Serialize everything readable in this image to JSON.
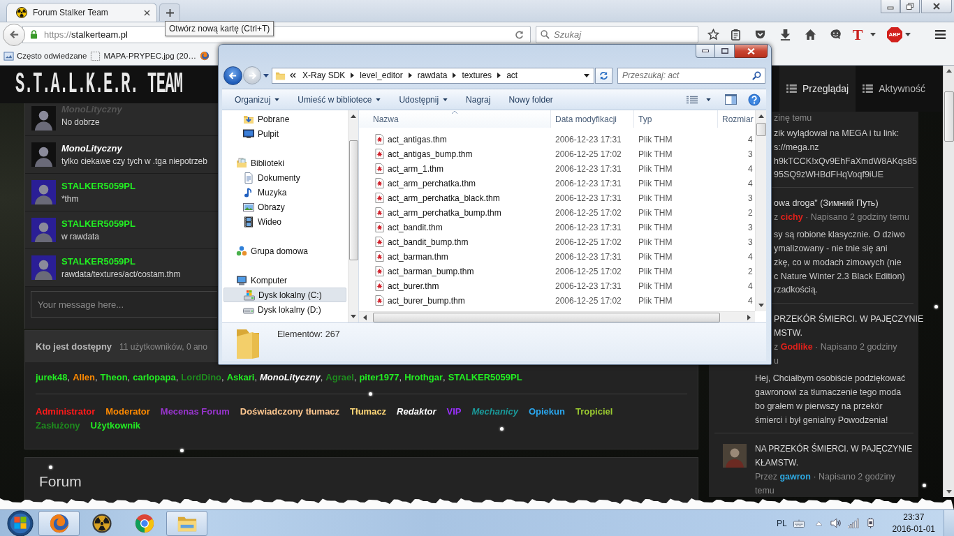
{
  "browser": {
    "tabs": [
      {
        "title": "Forum Stalker Team",
        "selected": true
      }
    ],
    "tooltip": "Otwórz nową kartę (Ctrl+T)",
    "url": {
      "scheme": "https://",
      "host": "stalkerteam.pl"
    },
    "search": {
      "placeholder": "Szukaj"
    },
    "extension_label": "T",
    "adblock_label": "ABP",
    "bookmarks": [
      {
        "label": "Często odwiedzane"
      },
      {
        "label": "MAPA-PRYPEC.jpg (20…"
      }
    ]
  },
  "page": {
    "logo": "S.T.A.L.K.E.R. TEAM",
    "nav": [
      {
        "label": "Przeglądaj",
        "selected": true
      },
      {
        "label": "Aktywność",
        "selected": false
      }
    ],
    "chat": {
      "messages": [
        {
          "author": "MonoLityczny",
          "color": "#555555",
          "italic": true,
          "avatar": {
            "color": "#101010"
          },
          "text": "No dobrze"
        },
        {
          "author": "MonoLityczny",
          "color": "#ffffff",
          "italic": true,
          "avatar": {
            "color": "#101010"
          },
          "text": "tylko ciekawe czy tych w .tga niepotrzeb"
        },
        {
          "author": "STALKER5059PL",
          "color": "#22ee22",
          "italic": false,
          "avatar": {
            "color": "#2a1e96"
          },
          "text": "*thm"
        },
        {
          "author": "STALKER5059PL",
          "color": "#22ee22",
          "italic": false,
          "avatar": {
            "color": "#2a1e96"
          },
          "text": "w rawdata"
        },
        {
          "author": "STALKER5059PL",
          "color": "#22ee22",
          "italic": false,
          "avatar": {
            "color": "#2a1e96"
          },
          "text": "rawdata/textures/act/costam.thm"
        }
      ],
      "input": {
        "placeholder": "Your message here..."
      }
    },
    "online": {
      "title": "Kto jest dostępny",
      "summary": "11 użytkowników, 0 ano",
      "users": [
        {
          "name": "jurek48",
          "color": "#22ee22",
          "italic": false,
          "separator": ","
        },
        {
          "name": "Allen",
          "color": "#ff8a00",
          "italic": false,
          "separator": ","
        },
        {
          "name": "Theon",
          "color": "#22ee22",
          "italic": false,
          "separator": ","
        },
        {
          "name": "carlopapa",
          "color": "#22ee22",
          "italic": false,
          "separator": ","
        },
        {
          "name": "LordDino",
          "color": "#1e8b1e",
          "italic": false,
          "separator": ","
        },
        {
          "name": "Askari",
          "color": "#22ee22",
          "italic": false,
          "separator": ","
        },
        {
          "name": "MonoLityczny",
          "color": "#ffffff",
          "italic": true,
          "separator": ","
        },
        {
          "name": "Agrael",
          "color": "#1e8b1e",
          "italic": false,
          "separator": ","
        },
        {
          "name": "piter1977",
          "color": "#22ee22",
          "italic": false,
          "separator": ","
        },
        {
          "name": "Hrothgar",
          "color": "#22ee22",
          "italic": false,
          "separator": ","
        },
        {
          "name": "STALKER5059PL",
          "color": "#22ee22",
          "italic": false
        }
      ],
      "roles": [
        {
          "label": "Administrator",
          "color": "#ff1a1a",
          "italic": false
        },
        {
          "label": "Moderator",
          "color": "#ff8a00",
          "italic": false
        },
        {
          "label": "Mecenas Forum",
          "color": "#9a35d0",
          "italic": false
        },
        {
          "label": "Doświadczony tłumacz",
          "color": "#ffc890",
          "italic": false
        },
        {
          "label": "Tłumacz",
          "color": "#ffd878",
          "italic": false
        },
        {
          "label": "Redaktor",
          "color": "#ffffff",
          "italic": true
        },
        {
          "label": "VIP",
          "color": "#9b30ff",
          "italic": false
        },
        {
          "label": "Mechanicy",
          "color": "#1a9a9a",
          "italic": true
        },
        {
          "label": "Opiekun",
          "color": "#2aa8f0",
          "italic": false
        },
        {
          "label": "Tropiciel",
          "color": "#9ccc30",
          "italic": false
        },
        {
          "label": "Zasłużony",
          "color": "#1e8b1e",
          "italic": false
        },
        {
          "label": "Użytkownik",
          "color": "#22ee22",
          "italic": false
        }
      ]
    },
    "forum": {
      "title": "Forum"
    },
    "activity": {
      "posts": [
        {
          "kind": "covered",
          "meta": {
            "date": "zinę temu"
          },
          "body_lines": [
            "zik wylądował na MEGA i tu link:",
            "s://mega.nz",
            "h9kTCCK!xQv9EhFaXmdW8AKqs85",
            "95SQ9zWHBdFHqVoqf9iUE"
          ]
        },
        {
          "kind": "covered",
          "title_lines": [
            "owa droga\" (Зимний Путь)"
          ],
          "meta": {
            "by": "z",
            "author": "cichy",
            "color": "#e3211b",
            "separator": "·",
            "date": "Napisano 2 godziny temu"
          },
          "body_lines": [
            "sy są robione klasycznie. O dziwo",
            "ymalizowany - nie tnie się ani",
            "zkę, co w modach zimowych (nie",
            "c Nature Winter 2.3 Black Edition)",
            "rzadkością."
          ]
        },
        {
          "kind": "half_covered",
          "title_lines": [
            "PRZEKÓR ŚMIERCI. W PAJĘCZYNIE",
            "MSTW."
          ],
          "meta": {
            "by": "z",
            "author": "Godlike",
            "color": "#e3211b",
            "separator": "·",
            "date": "Napisano 2 godziny",
            "date_tail": "u"
          },
          "body": "Hej, Chciałbym osobiście podziękować gawronowi za tłumaczenie tego moda bo grałem w pierwszy na przekór śmierci i był genialny  Powodzenia!"
        },
        {
          "kind": "full",
          "title": "NA PRZEKÓR ŚMIERCI. W PAJĘCZYNIE KŁAMSTW.",
          "meta": {
            "by": "Przez",
            "author": "gawron",
            "color": "#2ea8e0",
            "separator": "·",
            "date": "Napisano 2 godziny temu"
          }
        }
      ]
    }
  },
  "explorer": {
    "breadcrumbs": [
      "X-Ray SDK",
      "level_editor",
      "rawdata",
      "textures",
      "act"
    ],
    "search_placeholder": "Przeszukaj: act",
    "toolbar": [
      {
        "label": "Organizuj",
        "dropdown": true
      },
      {
        "label": "Umieść w bibliotece",
        "dropdown": true
      },
      {
        "label": "Udostępnij",
        "dropdown": true
      },
      {
        "label": "Nagraj",
        "dropdown": false
      },
      {
        "label": "Nowy folder",
        "dropdown": false
      }
    ],
    "nav": [
      {
        "children": [
          {
            "label": "Pobrane",
            "selected": false
          },
          {
            "label": "Pulpit",
            "selected": false
          }
        ]
      },
      {
        "label": "Biblioteki",
        "selected": false,
        "children": [
          {
            "label": "Dokumenty",
            "selected": false
          },
          {
            "label": "Muzyka",
            "selected": false
          },
          {
            "label": "Obrazy",
            "selected": false
          },
          {
            "label": "Wideo",
            "selected": false
          }
        ]
      },
      {
        "label": "Grupa domowa",
        "selected": false
      },
      {
        "label": "Komputer",
        "selected": false,
        "children": [
          {
            "label": "Dysk lokalny (C:)",
            "selected": true
          },
          {
            "label": "Dysk lokalny (D:)",
            "selected": false
          }
        ]
      }
    ],
    "columns": [
      {
        "label": "Nazwa",
        "sorted": true
      },
      {
        "label": "Data modyfikacji",
        "sorted": false
      },
      {
        "label": "Typ",
        "sorted": false
      },
      {
        "label": "Rozmiar",
        "sorted": false
      }
    ],
    "files": [
      {
        "name": "act_antigas.thm",
        "modified": "2006-12-23 17:31",
        "type": "Plik THM",
        "size": "4"
      },
      {
        "name": "act_antigas_bump.thm",
        "modified": "2006-12-25 17:02",
        "type": "Plik THM",
        "size": "3"
      },
      {
        "name": "act_arm_1.thm",
        "modified": "2006-12-23 17:31",
        "type": "Plik THM",
        "size": "4"
      },
      {
        "name": "act_arm_perchatka.thm",
        "modified": "2006-12-23 17:31",
        "type": "Plik THM",
        "size": "4"
      },
      {
        "name": "act_arm_perchatka_black.thm",
        "modified": "2006-12-23 17:31",
        "type": "Plik THM",
        "size": "3"
      },
      {
        "name": "act_arm_perchatka_bump.thm",
        "modified": "2006-12-25 17:02",
        "type": "Plik THM",
        "size": "2"
      },
      {
        "name": "act_bandit.thm",
        "modified": "2006-12-23 17:31",
        "type": "Plik THM",
        "size": "3"
      },
      {
        "name": "act_bandit_bump.thm",
        "modified": "2006-12-25 17:02",
        "type": "Plik THM",
        "size": "3"
      },
      {
        "name": "act_barman.thm",
        "modified": "2006-12-23 17:31",
        "type": "Plik THM",
        "size": "4"
      },
      {
        "name": "act_barman_bump.thm",
        "modified": "2006-12-25 17:02",
        "type": "Plik THM",
        "size": "2"
      },
      {
        "name": "act_burer.thm",
        "modified": "2006-12-23 17:31",
        "type": "Plik THM",
        "size": "4"
      },
      {
        "name": "act_burer_bump.thm",
        "modified": "2006-12-25 17:02",
        "type": "Plik THM",
        "size": "4"
      }
    ],
    "status": "Elementów: 267"
  },
  "taskbar": {
    "apps": [
      {
        "running": true
      },
      {
        "running": false
      },
      {
        "running": false
      },
      {
        "running": true
      }
    ],
    "language": "PL",
    "time": "23:37",
    "date": "2016-01-01"
  }
}
